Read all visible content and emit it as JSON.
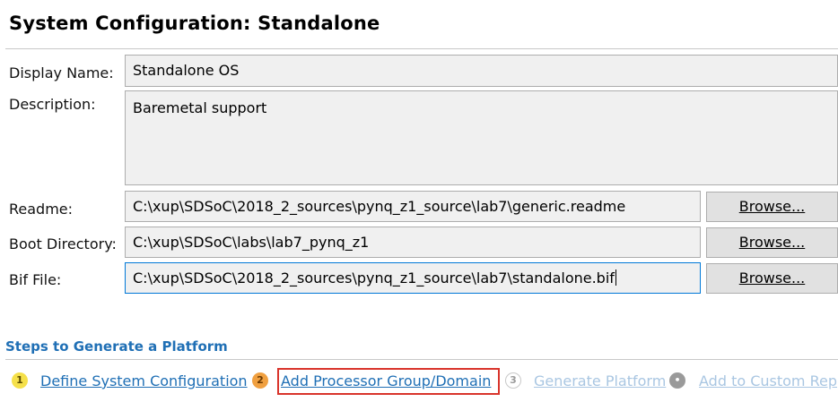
{
  "header": {
    "title": "System Configuration: Standalone"
  },
  "form": {
    "display_name": {
      "label": "Display Name:",
      "value": "Standalone OS"
    },
    "description": {
      "label": "Description:",
      "value": "Baremetal support"
    },
    "readme": {
      "label": "Readme:",
      "value": "C:\\xup\\SDSoC\\2018_2_sources\\pynq_z1_source\\lab7\\generic.readme",
      "browse_label": "Browse..."
    },
    "boot_directory": {
      "label": "Boot Directory:",
      "value": "C:\\xup\\SDSoC\\labs\\lab7_pynq_z1",
      "browse_label": "Browse..."
    },
    "bif_file": {
      "label": "Bif File:",
      "value": "C:\\xup\\SDSoC\\2018_2_sources\\pynq_z1_source\\lab7\\standalone.bif",
      "browse_label": "Browse..."
    }
  },
  "steps": {
    "title": "Steps to Generate a Platform",
    "items": [
      {
        "number": "1",
        "label": "Define System Configuration",
        "state": "done"
      },
      {
        "number": "2",
        "label": "Add Processor Group/Domain",
        "state": "current"
      },
      {
        "number": "3",
        "label": "Generate Platform",
        "state": "disabled"
      },
      {
        "number": "4",
        "label": "Add to Custom Rep",
        "state": "disabled"
      }
    ]
  },
  "colors": {
    "link": "#1f6fb5",
    "link_disabled": "#a9c6e2",
    "highlight_border": "#d9342b",
    "focus_border": "#0078d7"
  }
}
